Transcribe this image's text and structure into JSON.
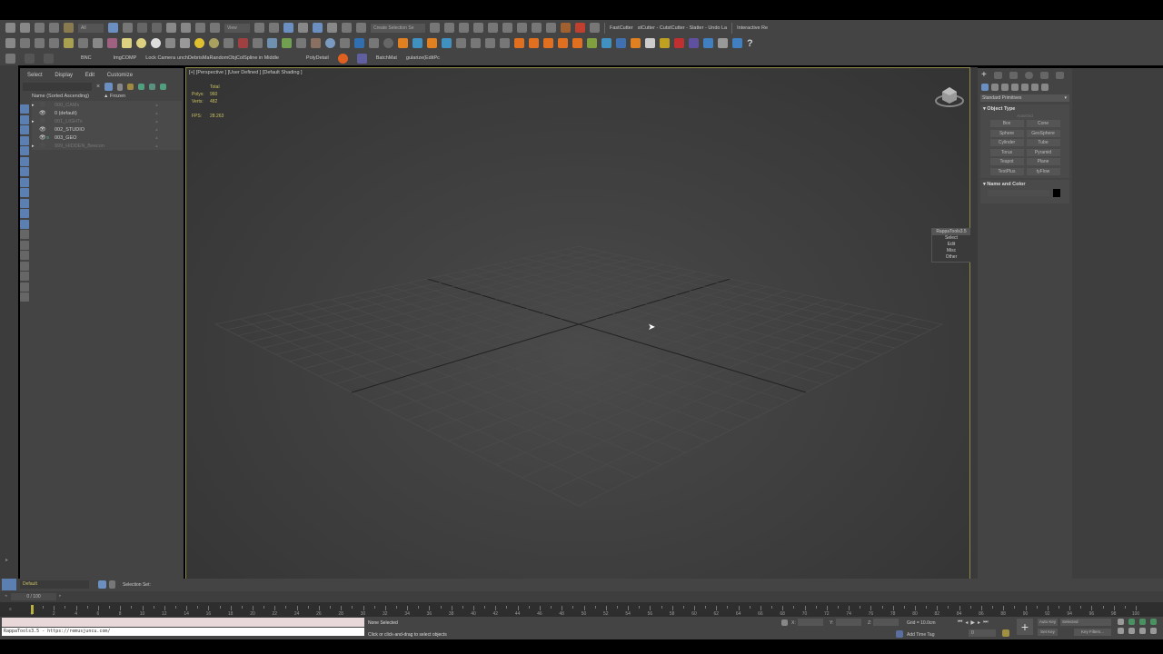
{
  "toolbar": {
    "selection_filter": "All",
    "ref_coord": "View",
    "named_selection": "Create Selection Se",
    "row1_texts": [
      "FastCutter",
      "stCutter - CutstCutter - Slatter - Undo La",
      "Interactive Re"
    ],
    "scripts": [
      "BNC",
      "ImgCOMP",
      "Lock Camera",
      "unchDebrisMa",
      "RandomObjColSpline in Middle",
      "PolyDetail",
      "BatchMat",
      "gularize(EditPc"
    ]
  },
  "explorer": {
    "menu": [
      "Select",
      "Display",
      "Edit",
      "Customize"
    ],
    "col_name": "Name (Sorted Ascending)",
    "col_frozen": "▲ Frozen",
    "layers": [
      {
        "name": "000_CAMs",
        "dim": true,
        "expand": true
      },
      {
        "name": "0 (default)",
        "dim": false,
        "expand": false
      },
      {
        "name": "001_LIGHTs",
        "dim": true,
        "expand": true
      },
      {
        "name": "002_STUDIO",
        "dim": false,
        "expand": false
      },
      {
        "name": "003_GEO",
        "dim": false,
        "expand": false
      },
      {
        "name": "999_HIDDEN_Beecon",
        "dim": true,
        "expand": true
      }
    ]
  },
  "viewport": {
    "label": "[+] [Perspective ] [User Defined ] [Default Shading ]",
    "stats_header": "Total",
    "polys_label": "Polys:",
    "polys": "960",
    "verts_label": "Verts:",
    "verts": "482",
    "fps_label": "FPS:",
    "fps": "28.263",
    "quad_menu": {
      "title": "RappaTools3.5",
      "items": [
        "Select",
        "Edit",
        "Misc",
        "Other"
      ]
    }
  },
  "command_panel": {
    "dropdown": "Standard Primitives",
    "object_type": "Object Type",
    "autogrid": "AutoGrid",
    "buttons": [
      "Box",
      "Cone",
      "Sphere",
      "GeoSphere",
      "Cylinder",
      "Tube",
      "Torus",
      "Pyramid",
      "Teapot",
      "Plane",
      "TextPlus",
      "tyFlow"
    ],
    "name_color": "Name and Color",
    "color": "#000000"
  },
  "bottom": {
    "layer": "Default",
    "selection_set": "Selection Set:",
    "time": "0 / 100",
    "ticks": [
      0,
      2,
      4,
      6,
      8,
      10,
      12,
      14,
      16,
      18,
      20,
      22,
      24,
      26,
      28,
      30,
      32,
      34,
      36,
      38,
      40,
      42,
      44,
      46,
      48,
      50,
      52,
      54,
      56,
      58,
      60,
      62,
      64,
      66,
      68,
      70,
      72,
      74,
      76,
      78,
      80,
      82,
      84,
      86,
      88,
      90,
      92,
      94,
      96,
      98,
      100
    ],
    "current_frame": 0,
    "listener": "RappaTools3.5 - https://remusjuncu.com/",
    "status": "None Selected",
    "prompt": "Click or click-and-drag to select objects",
    "x_label": "X:",
    "y_label": "Y:",
    "z_label": "Z:",
    "grid": "Grid = 10.0cm",
    "add_time_tag": "Add Time Tag",
    "auto_key": "Auto Key",
    "set_key": "Set Key",
    "key_mode": "Selected",
    "key_filters": "Key Filters...",
    "frame_field": "0"
  }
}
